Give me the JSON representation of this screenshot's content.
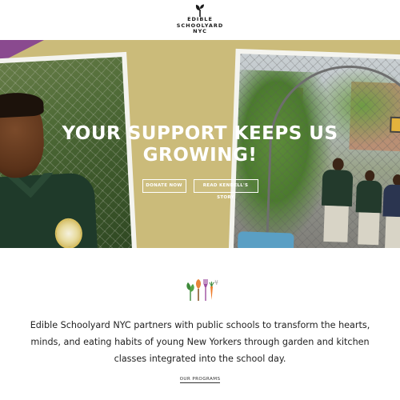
{
  "header": {
    "logo_lines": [
      "EDIBLE",
      "SCHOOLYARD",
      "NYC"
    ],
    "logo_icon": "sprout-icon"
  },
  "hero": {
    "title_line1": "YOUR SUPPORT KEEPS US",
    "title_line2": "GROWING!",
    "donate_label": "DONATE NOW",
    "story_label": "READ KENDELL'S STORY",
    "background_color": "#cbbb7a",
    "accent_purple": "#8a4a8f"
  },
  "mission": {
    "icons": [
      "leaf-icon",
      "trowel-icon",
      "fork-icon",
      "carrot-icon",
      "sprig-icon"
    ],
    "text": "Edible Schoolyard NYC partners with public schools to transform the hearts, minds, and eating habits of young New Yorkers through garden and kitchen classes integrated into the school day.",
    "programs_label": "OUR PROGRAMS"
  }
}
